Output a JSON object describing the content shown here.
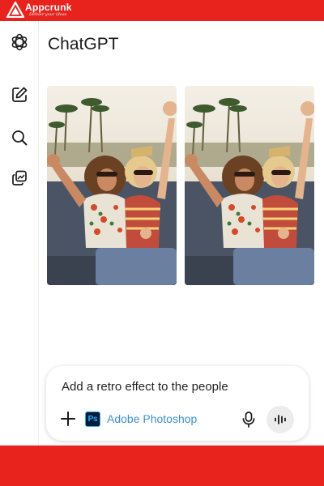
{
  "brand": {
    "name": "Appcrunk",
    "tagline": "Deliver your ideas",
    "bar_color": "#e8231d"
  },
  "sidebar": {
    "items": [
      {
        "icon": "openai-logo-icon"
      },
      {
        "icon": "new-chat-icon"
      },
      {
        "icon": "search-icon"
      },
      {
        "icon": "library-icon"
      }
    ]
  },
  "header": {
    "title": "ChatGPT"
  },
  "images": [
    {
      "name": "original-photo",
      "description": "two women in sunglasses cheering in a convertible"
    },
    {
      "name": "edited-photo",
      "description": "two women in sunglasses cheering in a convertible"
    }
  ],
  "composer": {
    "prompt": "Add a retro effect to the people",
    "tool": {
      "icon_text": "Ps",
      "label": "Adobe Photoshop"
    }
  }
}
